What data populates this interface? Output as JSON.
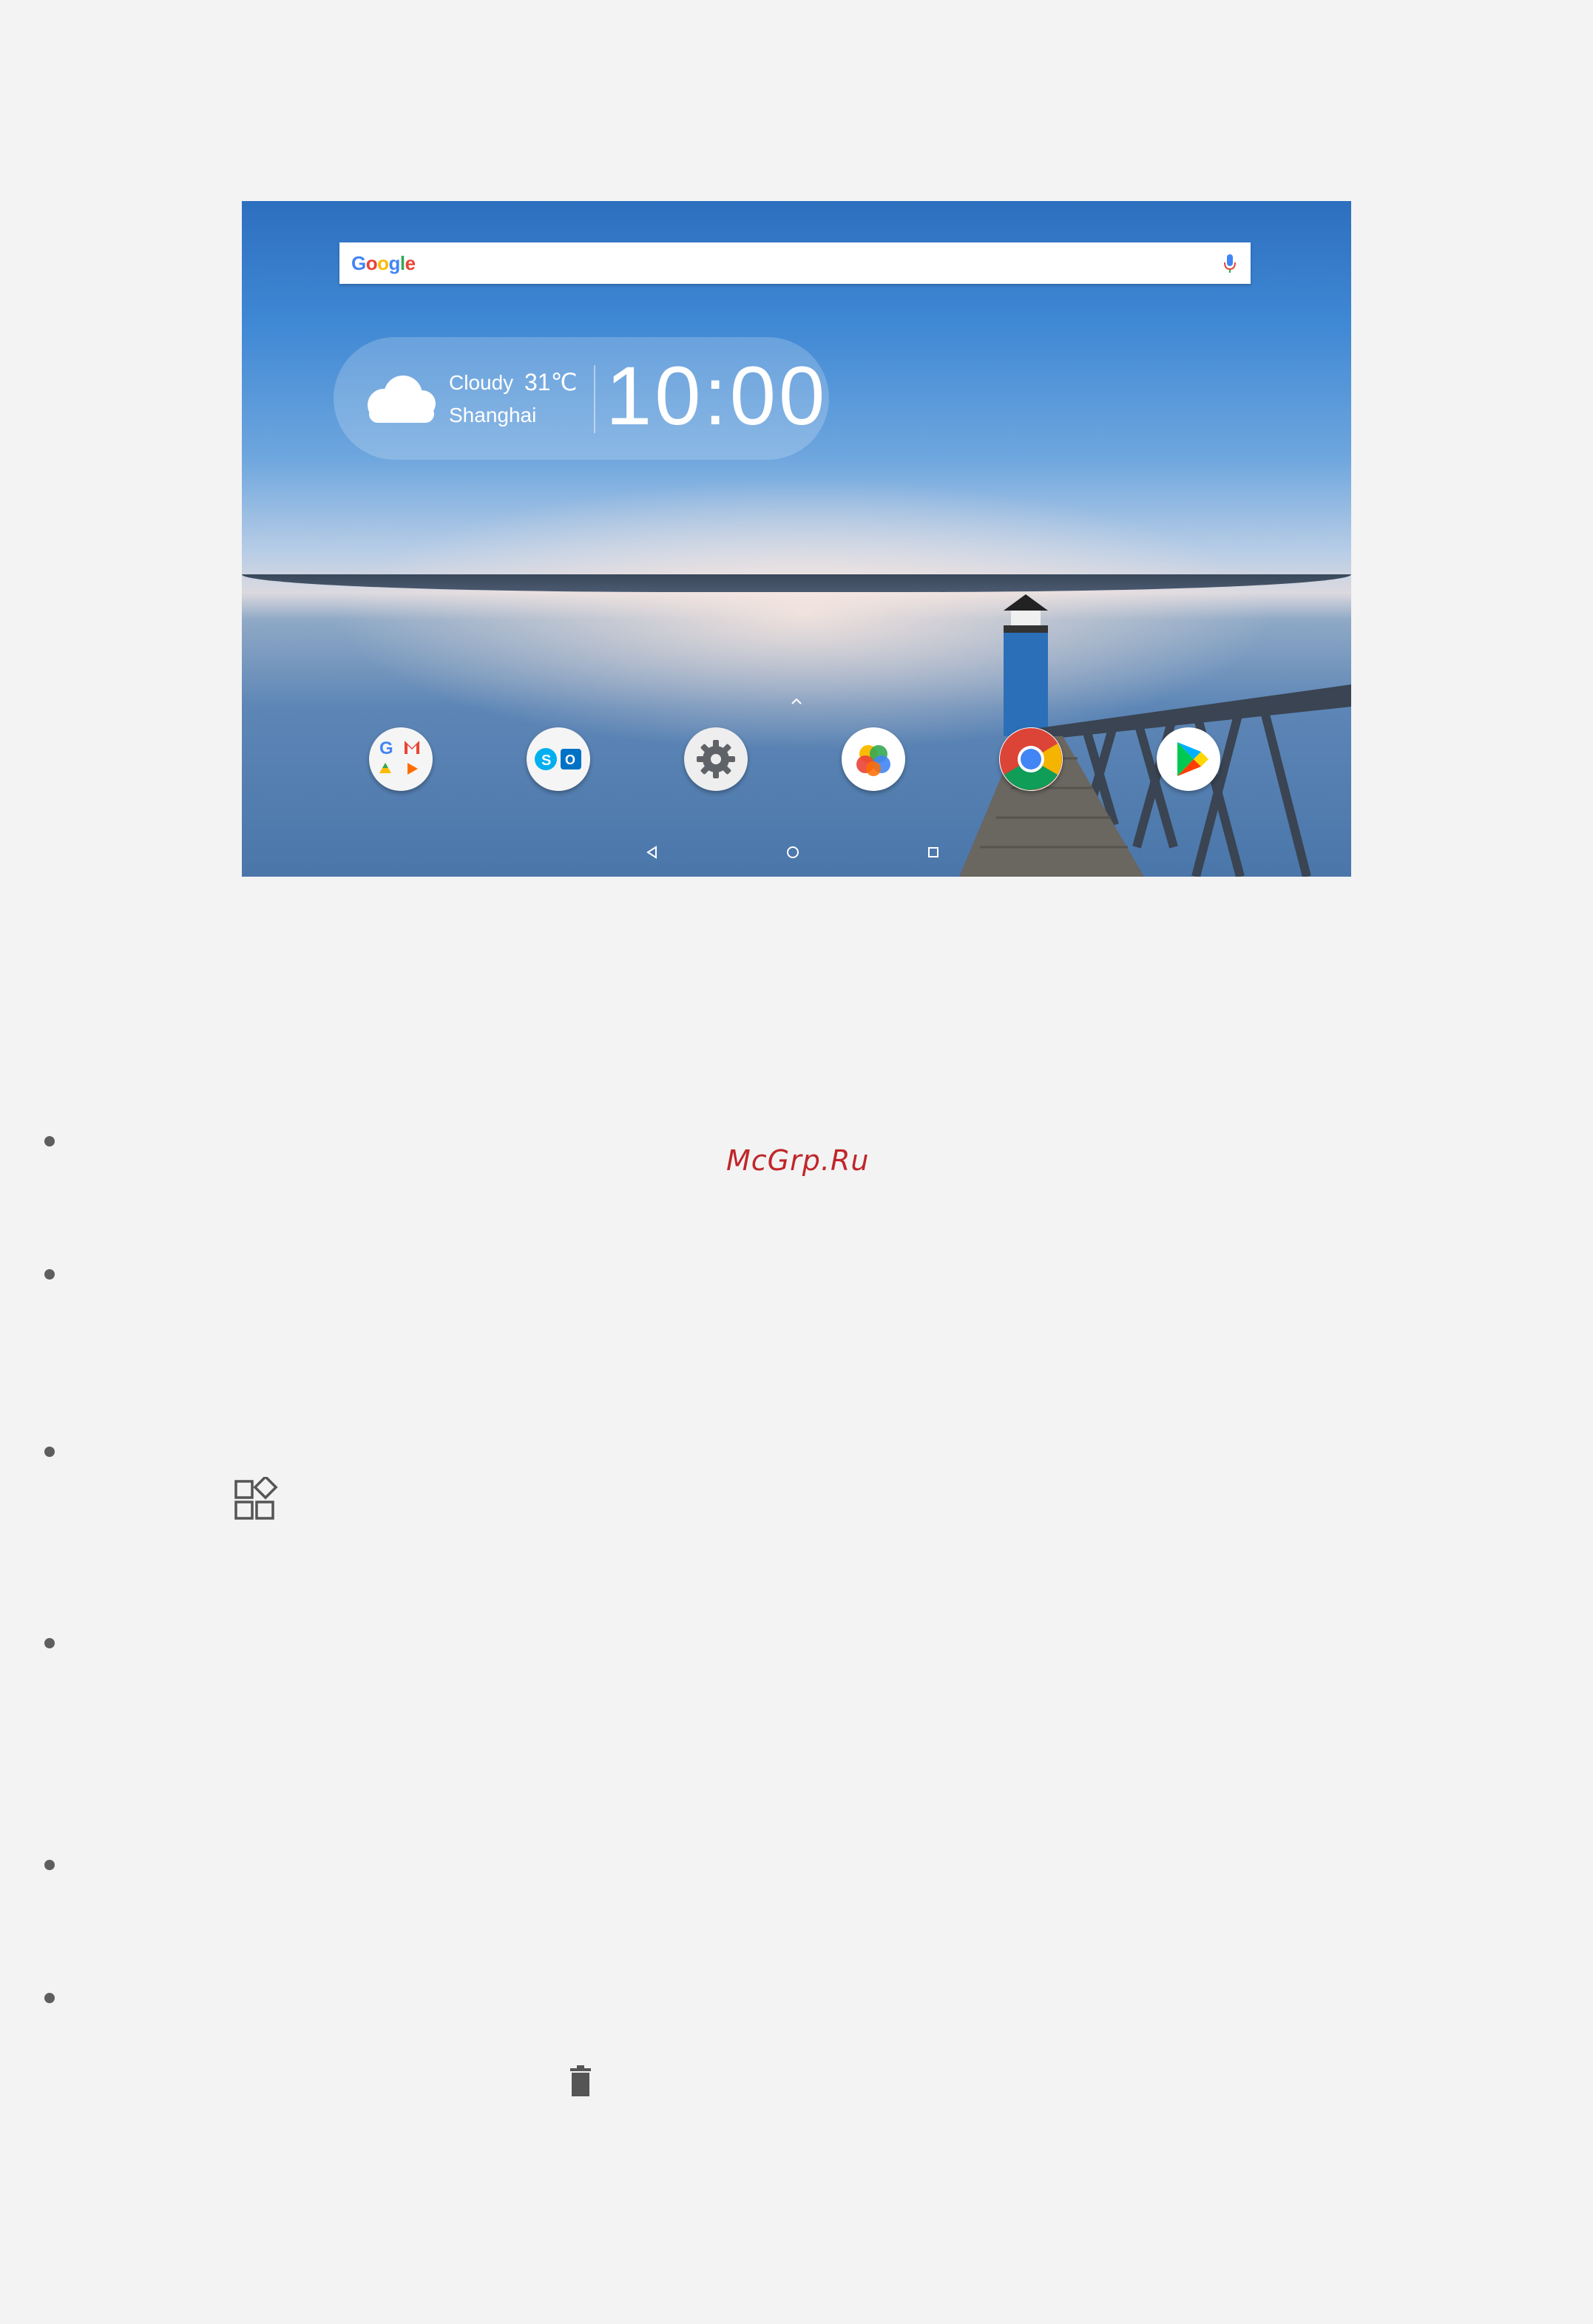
{
  "screen": {
    "search": {
      "logo_text": "Google"
    },
    "weather": {
      "condition": "Cloudy",
      "temperature": "31℃",
      "city": "Shanghai",
      "clock": "10:00"
    },
    "dock_icons": [
      {
        "name": "google-apps-folder-icon"
      },
      {
        "name": "skype-outlook-folder-icon"
      },
      {
        "name": "settings-icon"
      },
      {
        "name": "gallery-icon"
      },
      {
        "name": "chrome-icon"
      },
      {
        "name": "play-store-icon"
      }
    ],
    "nav": [
      "back",
      "home",
      "recents"
    ]
  },
  "document": {
    "watermark": "McGrp.Ru",
    "inline_icons": [
      "widgets-icon",
      "trash-icon"
    ],
    "bullet_count": 6
  },
  "colors": {
    "page_background": "#f3f3f3",
    "watermark": "#c0262a",
    "bullet": "#5e5e5e",
    "icon_gray": "#555555"
  }
}
